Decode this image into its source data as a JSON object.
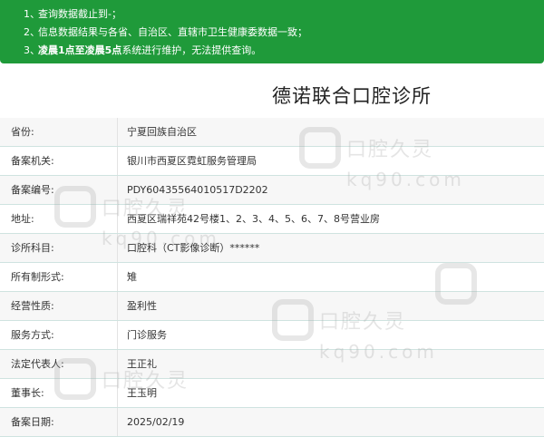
{
  "notice": {
    "line1": {
      "num": "1、",
      "text": "查询数据截止到-；"
    },
    "line2": {
      "num": "2、",
      "text": "信息数据结果与各省、自治区、直辖市卫生健康委数据一致；"
    },
    "line3": {
      "num": "3、",
      "bold": "凌晨1点至凌晨5点",
      "rest": "系统进行维护，无法提供查询。"
    }
  },
  "title": "德诺联合口腔诊所",
  "rows": [
    {
      "label": "省份:",
      "value": "宁夏回族自治区"
    },
    {
      "label": "备案机关:",
      "value": "银川市西夏区霓虹服务管理局"
    },
    {
      "label": "备案编号:",
      "value": "PDY60435564010517D2202"
    },
    {
      "label": "地址:",
      "value": "西夏区瑞祥苑42号楼1、2、3、4、5、6、7、8号营业房"
    },
    {
      "label": "诊所科目:",
      "value": "口腔科（CT影像诊断）******"
    },
    {
      "label": "所有制形式:",
      "value": "雉"
    },
    {
      "label": "经营性质:",
      "value": "盈利性"
    },
    {
      "label": "服务方式:",
      "value": "门诊服务"
    },
    {
      "label": "法定代表人:",
      "value": "王正礼"
    },
    {
      "label": "董事长:",
      "value": "王玉明"
    },
    {
      "label": "备案日期:",
      "value": "2025/02/19"
    }
  ],
  "watermark": {
    "brand": "口腔久灵",
    "domain": "kq90.com"
  }
}
